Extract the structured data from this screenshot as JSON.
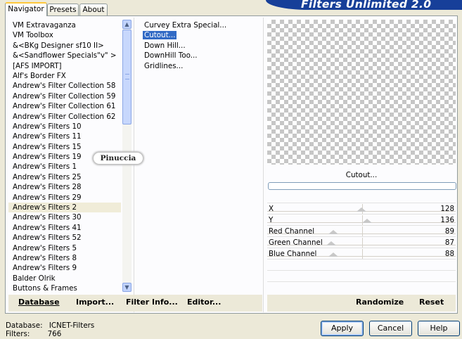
{
  "tabs": [
    "Navigator",
    "Presets",
    "About"
  ],
  "banner_title": "Filters Unlimited 2.0",
  "categories": [
    "VM Extravaganza",
    "VM Toolbox",
    "&<BKg Designer sf10 II>",
    "&<Sandflower Specials\"v\" >",
    "[AFS IMPORT]",
    "Alf's Border FX",
    "Andrew's Filter Collection 58",
    "Andrew's Filter Collection 59",
    "Andrew's Filter Collection 61",
    "Andrew's Filter Collection 62",
    "Andrew's Filters 10",
    "Andrew's Filters 11",
    "Andrew's Filters 15",
    "Andrew's Filters 19",
    "Andrew's Filters 1",
    "Andrew's Filters 25",
    "Andrew's Filters 28",
    "Andrew's Filters 29",
    "Andrew's Filters 2",
    "Andrew's Filters 30",
    "Andrew's Filters 41",
    "Andrew's Filters 52",
    "Andrew's Filters 5",
    "Andrew's Filters 8",
    "Andrew's Filters 9",
    "Balder Olrik",
    "Buttons & Frames"
  ],
  "selected_category_index": 18,
  "filters": [
    "Curvey Extra Special...",
    "Cutout...",
    "Down Hill...",
    "DownHill Too...",
    "Gridlines..."
  ],
  "selected_filter_index": 1,
  "preview_filter_name": "Cutout...",
  "params": [
    {
      "label": "X",
      "value": "128",
      "level": 0.5
    },
    {
      "label": "Y",
      "value": "136",
      "level": 0.53
    },
    {
      "label": "Red Channel",
      "value": "89",
      "level": 0.35
    },
    {
      "label": "Green Channel",
      "value": "87",
      "level": 0.34
    },
    {
      "label": "Blue Channel",
      "value": "88",
      "level": 0.35
    }
  ],
  "commands": {
    "database": "Database",
    "import": "Import...",
    "filter_info": "Filter Info...",
    "editor": "Editor...",
    "randomize": "Randomize",
    "reset": "Reset"
  },
  "status": {
    "database_label": "Database:",
    "database_value": "ICNET-Filters",
    "filters_label": "Filters:",
    "filters_value": "766"
  },
  "buttons": {
    "apply": "Apply",
    "cancel": "Cancel",
    "help": "Help"
  },
  "watermark": "Pinuccia",
  "colors": {
    "banner": "#173f99",
    "selection": "#316ac5"
  }
}
